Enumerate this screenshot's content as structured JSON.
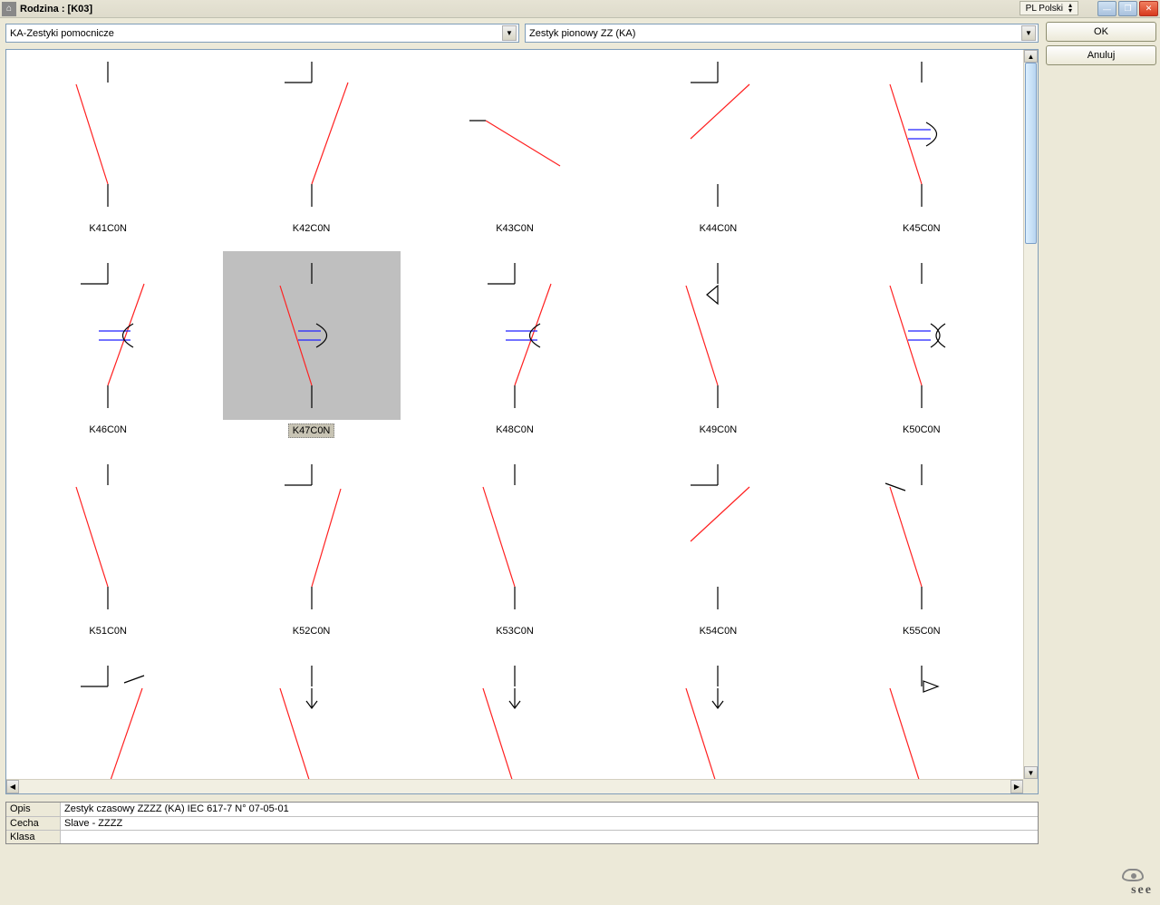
{
  "window": {
    "title": "Rodzina : [K03]",
    "language": "PL Polski"
  },
  "buttons": {
    "ok": "OK",
    "cancel": "Anuluj"
  },
  "combos": {
    "left": "KA-Zestyki pomocnicze",
    "right": "Zestyk pionowy ZZ (KA)"
  },
  "cells": [
    {
      "label": "K41C0N",
      "kind": "nc_plain",
      "selected": false
    },
    {
      "label": "K42C0N",
      "kind": "no_bar",
      "selected": false
    },
    {
      "label": "K43C0N",
      "kind": "no_plain",
      "selected": false
    },
    {
      "label": "K44C0N",
      "kind": "nc_bar",
      "selected": false
    },
    {
      "label": "K45C0N",
      "kind": "nc_halfarc",
      "selected": false
    },
    {
      "label": "K46C0N",
      "kind": "no_arc_bar",
      "selected": false
    },
    {
      "label": "K47C0N",
      "kind": "nc_halfarc",
      "selected": true
    },
    {
      "label": "K48C0N",
      "kind": "no_arc_bar",
      "selected": false
    },
    {
      "label": "K49C0N",
      "kind": "nc_tri",
      "selected": false
    },
    {
      "label": "K50C0N",
      "kind": "nc_arc2",
      "selected": false
    },
    {
      "label": "K51C0N",
      "kind": "nc_plain",
      "selected": false
    },
    {
      "label": "K52C0N",
      "kind": "no_bar_plain",
      "selected": false
    },
    {
      "label": "K53C0N",
      "kind": "nc_plain",
      "selected": false
    },
    {
      "label": "K54C0N",
      "kind": "nc_bar",
      "selected": false
    },
    {
      "label": "K55C0N",
      "kind": "nc_bar2",
      "selected": false
    },
    {
      "label": "",
      "kind": "no_bar_tick",
      "selected": false
    },
    {
      "label": "",
      "kind": "nc_arrow",
      "selected": false
    },
    {
      "label": "",
      "kind": "nc_arrow",
      "selected": false
    },
    {
      "label": "",
      "kind": "nc_arrow",
      "selected": false
    },
    {
      "label": "",
      "kind": "nc_tri2",
      "selected": false
    }
  ],
  "info": {
    "opis_label": "Opis",
    "opis_value": "Zestyk czasowy ZZZZ (KA) IEC 617-7  N° 07-05-01",
    "cecha_label": "Cecha",
    "cecha_value": "Slave - ZZZZ",
    "klasa_label": "Klasa",
    "klasa_value": ""
  },
  "logo": "see"
}
